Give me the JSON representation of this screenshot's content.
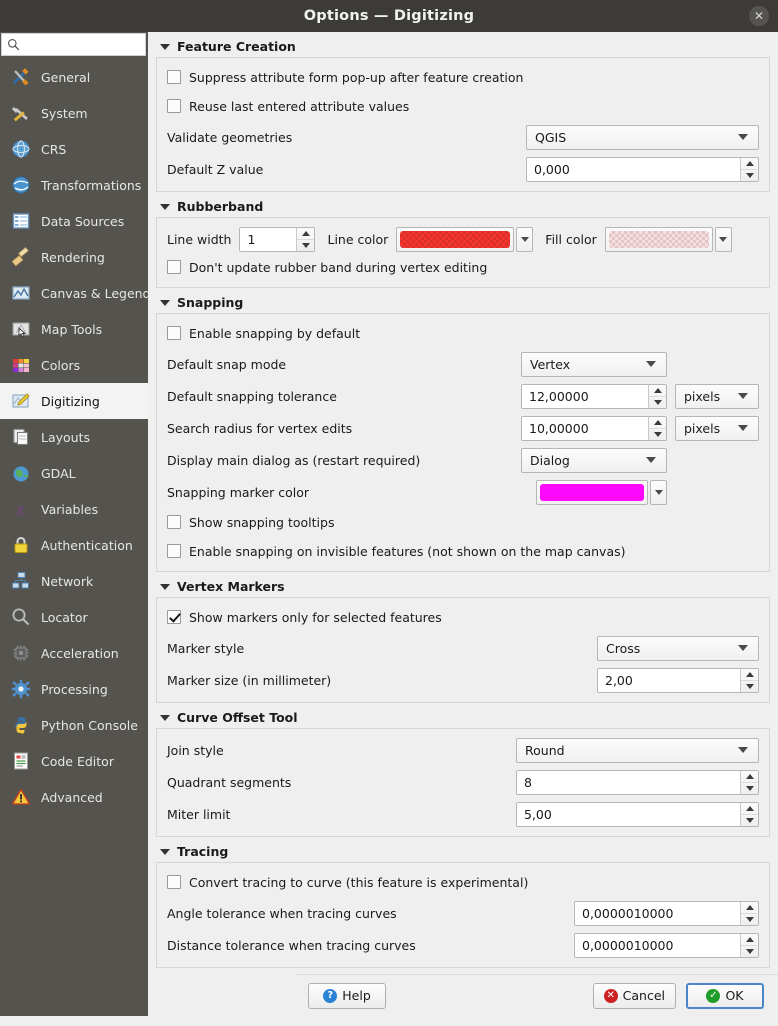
{
  "window": {
    "title": "Options — Digitizing",
    "close_label": "✕"
  },
  "search": {
    "value": "",
    "placeholder": ""
  },
  "sidebar": {
    "items": [
      {
        "label": "General",
        "icon": "hammer-screwdriver-icon"
      },
      {
        "label": "System",
        "icon": "wrench-screwdriver-icon"
      },
      {
        "label": "CRS",
        "icon": "globe-grid-icon"
      },
      {
        "label": "Transformations",
        "icon": "globe-arrows-icon"
      },
      {
        "label": "Data Sources",
        "icon": "table-icon"
      },
      {
        "label": "Rendering",
        "icon": "paintbrush-icon"
      },
      {
        "label": "Canvas & Legend",
        "icon": "canvas-icon"
      },
      {
        "label": "Map Tools",
        "icon": "map-cursor-icon"
      },
      {
        "label": "Colors",
        "icon": "color-swatches-icon"
      },
      {
        "label": "Digitizing",
        "icon": "digitizing-pencil-icon",
        "active": true
      },
      {
        "label": "Layouts",
        "icon": "layouts-pages-icon"
      },
      {
        "label": "GDAL",
        "icon": "gdal-globe-icon"
      },
      {
        "label": "Variables",
        "icon": "epsilon-icon"
      },
      {
        "label": "Authentication",
        "icon": "padlock-icon"
      },
      {
        "label": "Network",
        "icon": "network-nodes-icon"
      },
      {
        "label": "Locator",
        "icon": "magnifier-icon"
      },
      {
        "label": "Acceleration",
        "icon": "cpu-chip-icon"
      },
      {
        "label": "Processing",
        "icon": "gear-icon"
      },
      {
        "label": "Python Console",
        "icon": "python-icon"
      },
      {
        "label": "Code Editor",
        "icon": "code-document-icon"
      },
      {
        "label": "Advanced",
        "icon": "warning-triangle-icon"
      }
    ]
  },
  "groups": {
    "feature_creation": {
      "title": "Feature Creation",
      "suppress_form": {
        "label": "Suppress attribute form pop-up after feature creation",
        "checked": false
      },
      "reuse_values": {
        "label": "Reuse last entered attribute values",
        "checked": false
      },
      "validate_geometries": {
        "label": "Validate geometries",
        "value": "QGIS"
      },
      "default_z": {
        "label": "Default Z value",
        "value": "0,000"
      }
    },
    "rubberband": {
      "title": "Rubberband",
      "line_width": {
        "label": "Line width",
        "value": "1"
      },
      "line_color": {
        "label": "Line color",
        "color": "#f4352f"
      },
      "fill_color": {
        "label": "Fill color",
        "color": "#f9dcdc"
      },
      "dont_update": {
        "label": "Don't update rubber band during vertex editing",
        "checked": false
      }
    },
    "snapping": {
      "title": "Snapping",
      "enable_default": {
        "label": "Enable snapping by default",
        "checked": false
      },
      "snap_mode": {
        "label": "Default snap mode",
        "value": "Vertex"
      },
      "tolerance": {
        "label": "Default snapping tolerance",
        "value": "12,00000",
        "unit": "pixels"
      },
      "search_radius": {
        "label": "Search radius for vertex edits",
        "value": "10,00000",
        "unit": "pixels"
      },
      "main_dialog": {
        "label": "Display main dialog as (restart required)",
        "value": "Dialog"
      },
      "marker_color": {
        "label": "Snapping marker color",
        "color": "#fa09fa"
      },
      "show_tooltips": {
        "label": "Show snapping tooltips",
        "checked": false
      },
      "invisible_features": {
        "label": "Enable snapping on invisible features (not shown on the map canvas)",
        "checked": false
      }
    },
    "vertex_markers": {
      "title": "Vertex Markers",
      "only_selected": {
        "label": "Show markers only for selected features",
        "checked": true
      },
      "marker_style": {
        "label": "Marker style",
        "value": "Cross"
      },
      "marker_size": {
        "label": "Marker size (in millimeter)",
        "value": "2,00"
      }
    },
    "curve_offset": {
      "title": "Curve Offset Tool",
      "join_style": {
        "label": "Join style",
        "value": "Round"
      },
      "quadrant_segments": {
        "label": "Quadrant segments",
        "value": "8"
      },
      "miter_limit": {
        "label": "Miter limit",
        "value": "5,00"
      }
    },
    "tracing": {
      "title": "Tracing",
      "convert_to_curve": {
        "label": "Convert tracing to curve (this feature is experimental)",
        "checked": false
      },
      "angle_tolerance": {
        "label": "Angle tolerance when tracing curves",
        "value": "0,0000010000"
      },
      "distance_tolerance": {
        "label": "Distance tolerance when tracing curves",
        "value": "0,0000010000"
      }
    }
  },
  "footer": {
    "help": "Help",
    "cancel": "Cancel",
    "ok": "OK"
  }
}
